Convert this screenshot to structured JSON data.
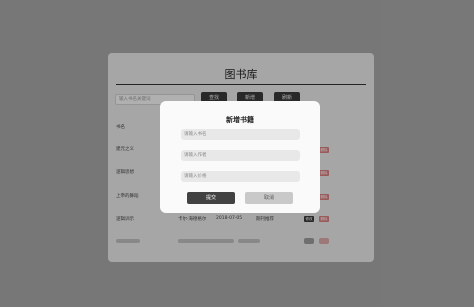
{
  "app": {
    "title": "图书库"
  },
  "toolbar": {
    "search_placeholder": "输入书名关键词",
    "buttons": [
      "查找",
      "新增",
      "刷新"
    ]
  },
  "table": {
    "rows": [
      {
        "name": "书名"
      },
      {
        "name": "建元之义"
      },
      {
        "name": "逻辑思想"
      },
      {
        "name": "上帝的舞蹈"
      },
      {
        "name": "逻辑训示",
        "extra": "卡尔·海德格尔",
        "date": "2018-07-05",
        "note": "期刊推荐"
      }
    ],
    "edit_label": "修改",
    "delete_label": "删除"
  },
  "modal": {
    "title": "新增书籍",
    "fields": [
      {
        "placeholder": "请输入书名"
      },
      {
        "placeholder": "请输入作者"
      },
      {
        "placeholder": "请输入价格"
      }
    ],
    "submit_label": "提交",
    "cancel_label": "取消"
  },
  "colors": {
    "overlay": "#a6a6a6",
    "panel": "#e6e6e6",
    "primary_button": "#3a3a3a",
    "danger_button": "#d67d7d"
  }
}
